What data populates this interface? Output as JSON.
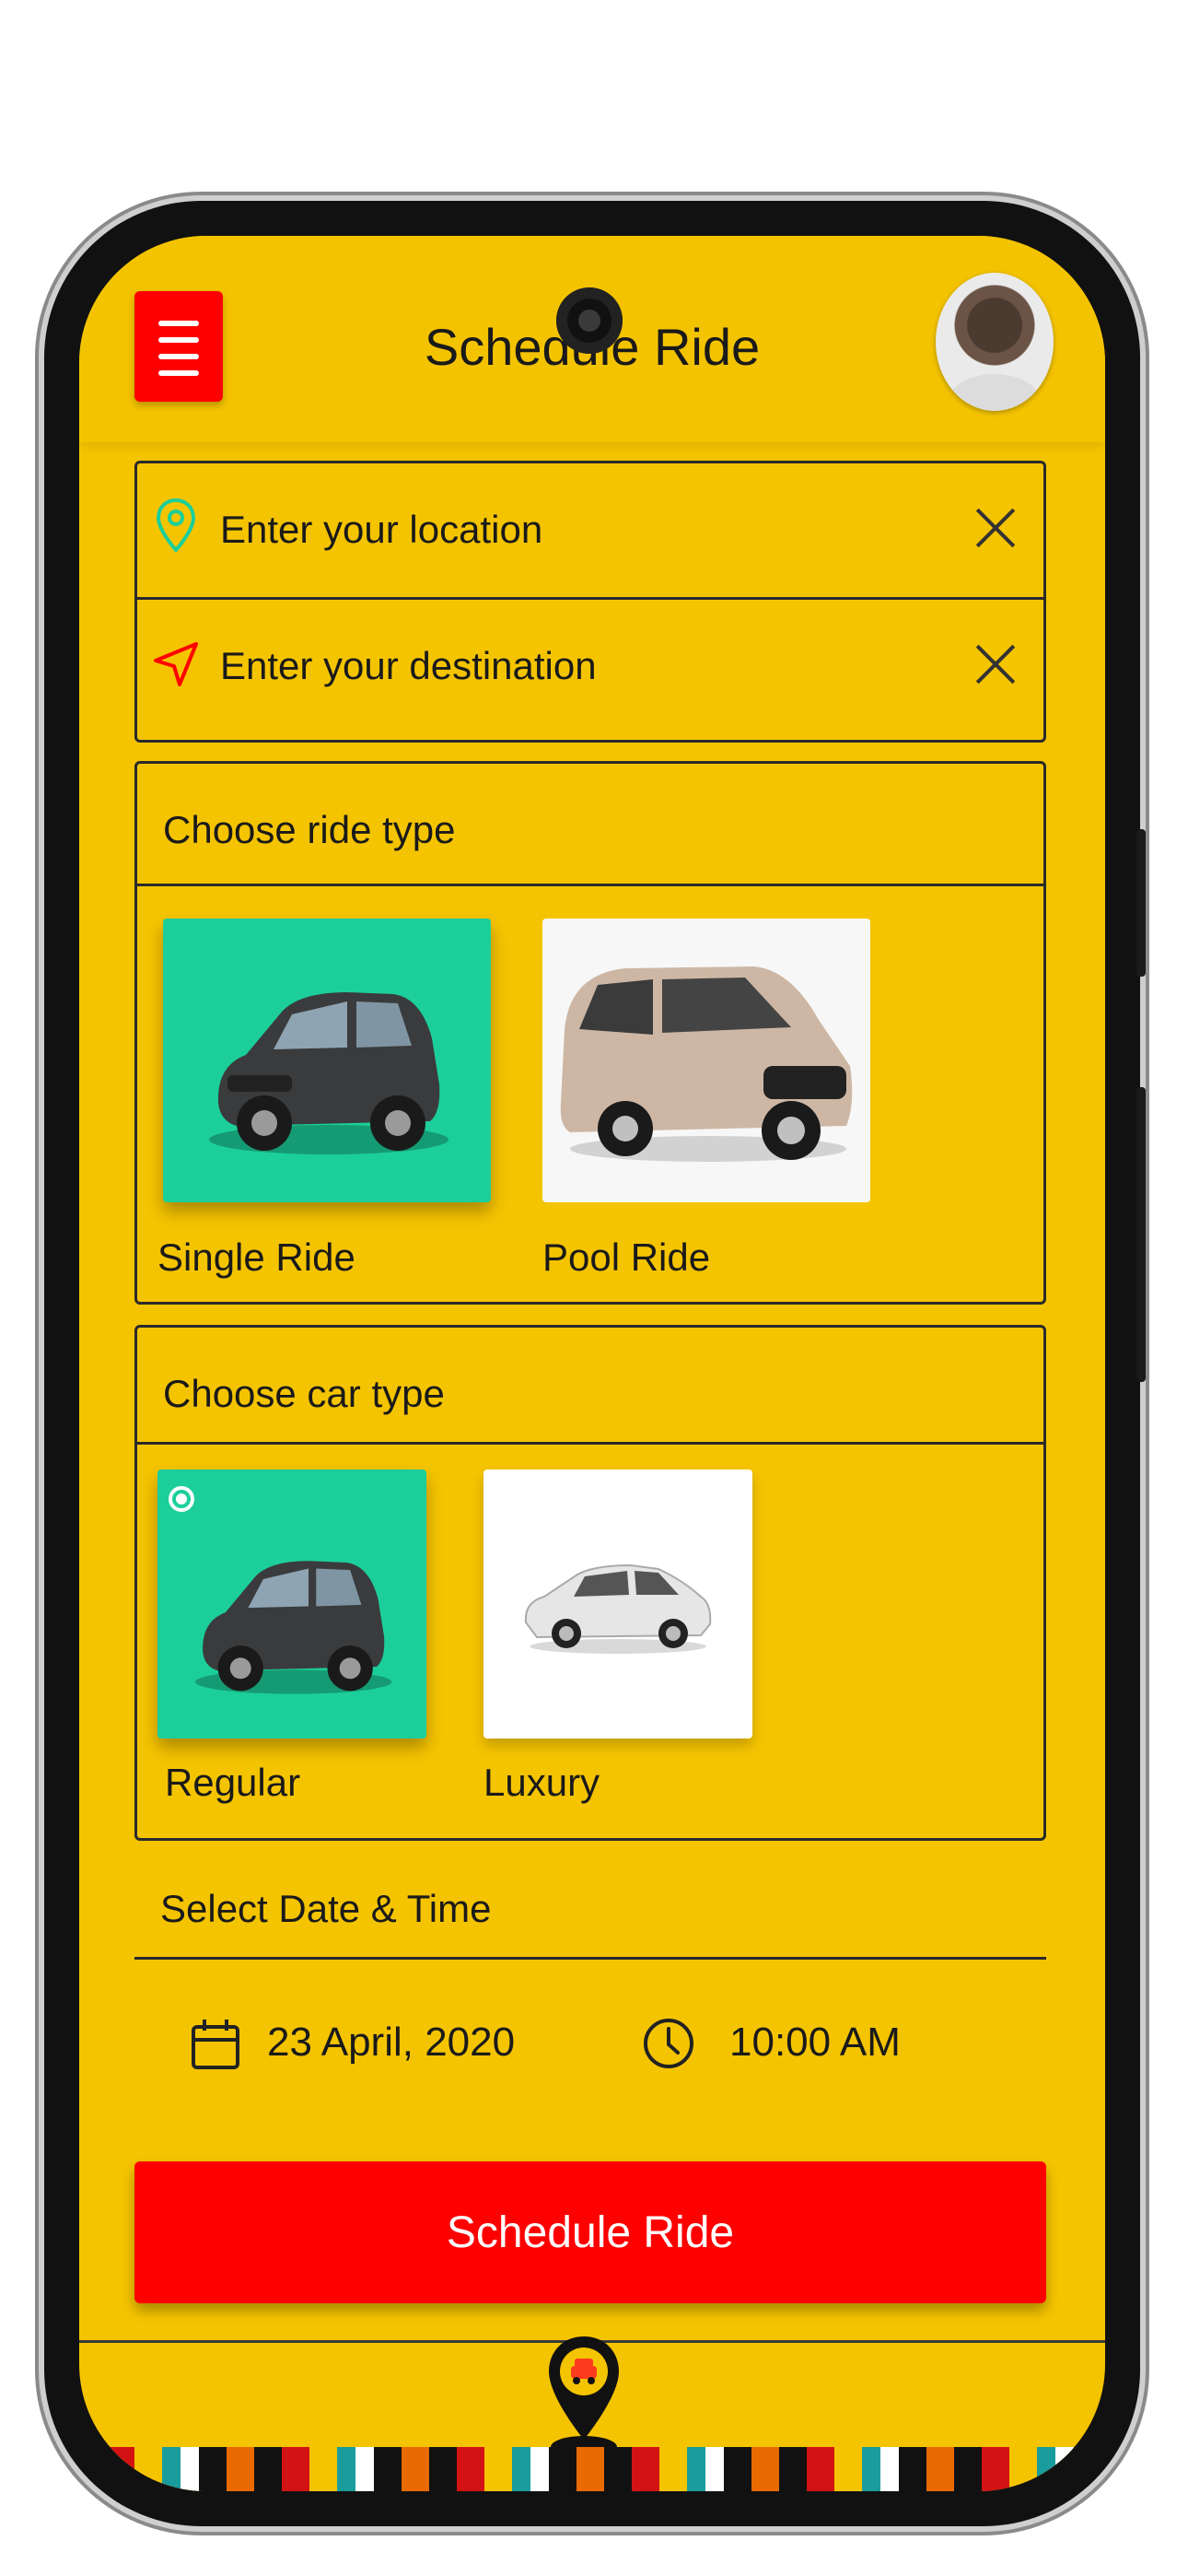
{
  "header": {
    "title": "Schedule Ride"
  },
  "location": {
    "placeholder": "Enter your location"
  },
  "destination": {
    "placeholder": "Enter your destination"
  },
  "ride_type": {
    "title": "Choose ride type",
    "options": [
      {
        "label": "Single Ride",
        "selected": true
      },
      {
        "label": "Pool Ride",
        "selected": false
      }
    ]
  },
  "car_type": {
    "title": "Choose car type",
    "options": [
      {
        "label": "Regular",
        "selected": true
      },
      {
        "label": "Luxury",
        "selected": false
      }
    ]
  },
  "datetime": {
    "title": "Select Date & Time",
    "date": "23 April, 2020",
    "time": "10:00 AM"
  },
  "action": {
    "label": "Schedule Ride"
  },
  "colors": {
    "background": "#f5c400",
    "accent": "#ff0000",
    "selected": "#1ccf9a"
  },
  "icons": [
    "menu-icon",
    "location-pin-icon",
    "navigation-arrow-icon",
    "close-icon",
    "calendar-icon",
    "clock-icon",
    "car-pin-icon"
  ]
}
